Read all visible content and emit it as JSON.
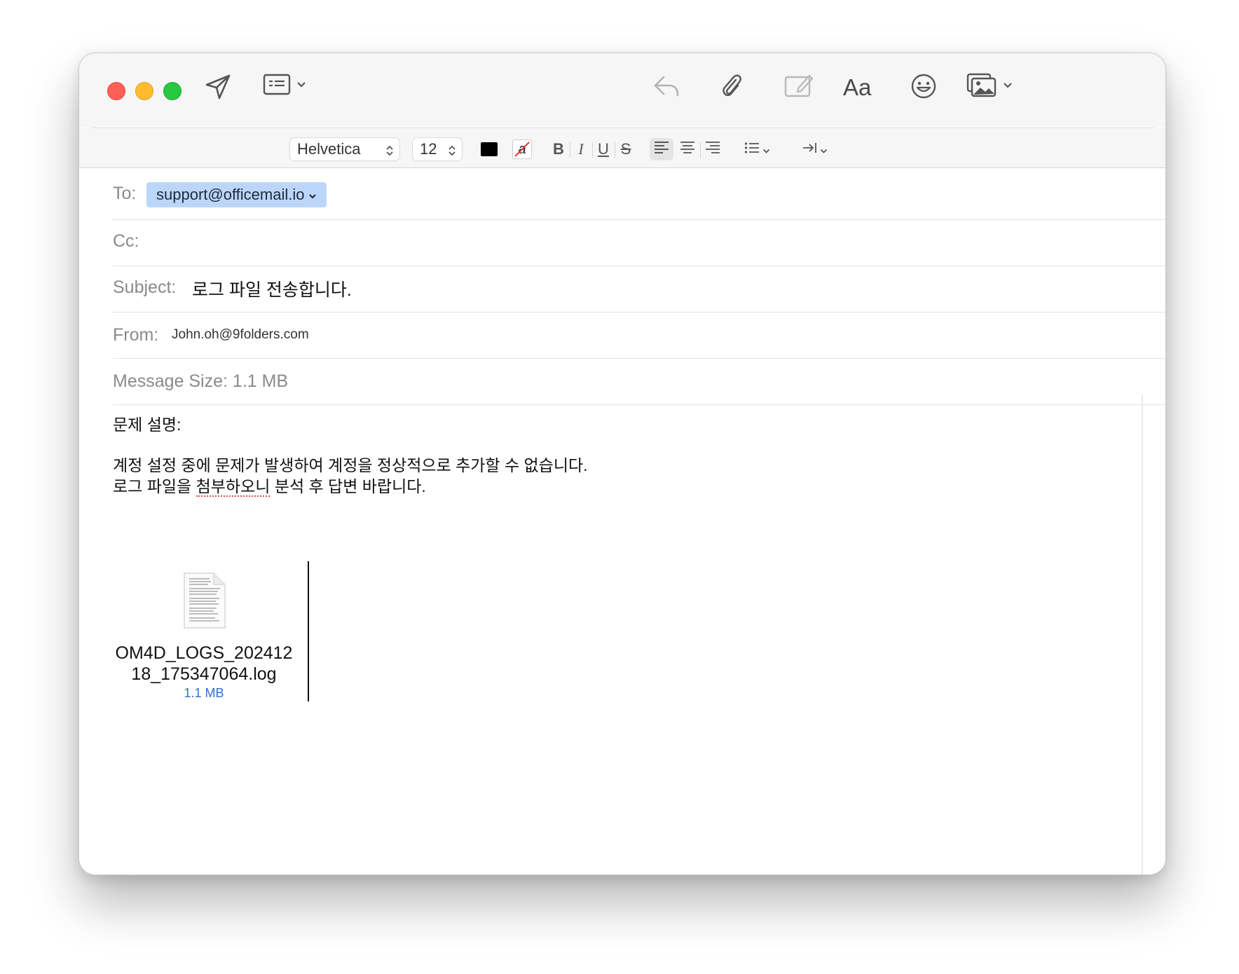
{
  "toolbar": {
    "icons": [
      "send-icon",
      "header-fields-icon",
      "reply-icon",
      "paperclip-icon",
      "markup-icon",
      "font-panel-icon",
      "emoji-icon",
      "photo-browser-icon"
    ],
    "font_panel_label": "Aa"
  },
  "format": {
    "font_family": "Helvetica",
    "font_size": "12",
    "text_color": "#000000",
    "bold_label": "B",
    "italic_label": "I",
    "underline_label": "U",
    "strike_label": "S",
    "highlight_label": "a"
  },
  "headers": {
    "to_label": "To:",
    "to_value": "support@officemail.io",
    "cc_label": "Cc:",
    "subject_label": "Subject:",
    "subject_value": "로그 파일 전송합니다.",
    "from_label": "From:",
    "from_value": "John.oh@9folders.com",
    "size_label": "Message Size:",
    "size_value": "1.1 MB"
  },
  "body": {
    "line1": "문제 설명:",
    "line2": "계정 설정 중에 문제가 발생하여 계정을 정상적으로 추가할 수 없습니다.",
    "line3_a": "로그 파일을 ",
    "line3_b": "첨부하오니",
    "line3_c": " 분석 후 답변 바랍니다."
  },
  "attachment": {
    "name": "OM4D_LOGS_20241218_175347064.log",
    "size": "1.1 MB"
  },
  "colors": {
    "recipient_bg": "#bcd6fa",
    "attachment_size": "#2e6fd6",
    "close": "#fe5f57",
    "minimize": "#febc2e",
    "zoom": "#28c840"
  }
}
